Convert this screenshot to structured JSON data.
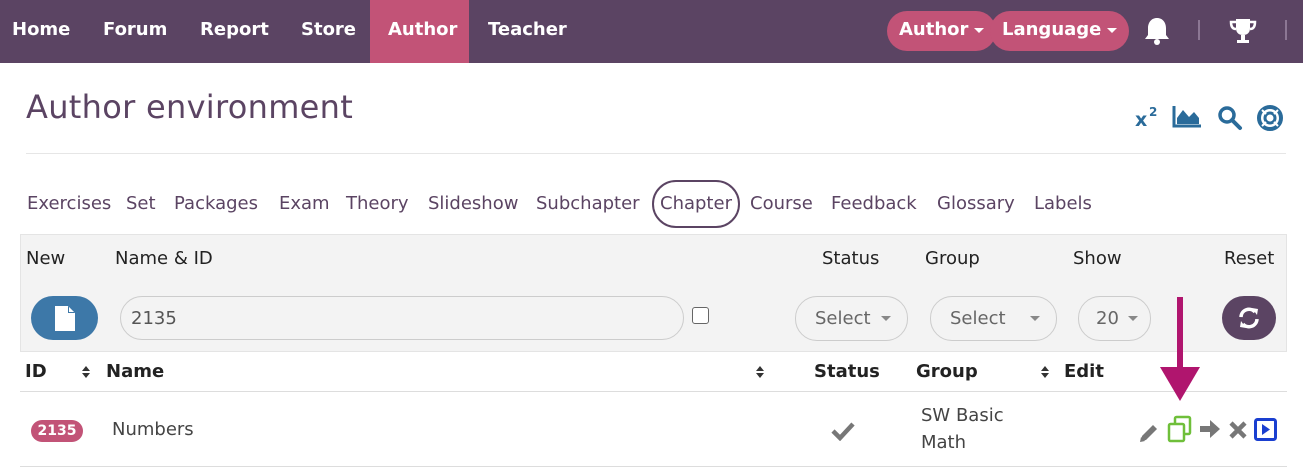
{
  "nav": {
    "links": [
      "Home",
      "Forum",
      "Report",
      "Store",
      "Author",
      "Teacher"
    ],
    "author_dropdown": "Author",
    "language_dropdown": "Language"
  },
  "page": {
    "title": "Author environment"
  },
  "tabs": [
    "Exercises",
    "Set",
    "Packages",
    "Exam",
    "Theory",
    "Slideshow",
    "Subchapter",
    "Chapter",
    "Course",
    "Feedback",
    "Glossary",
    "Labels"
  ],
  "active_tab": "Chapter",
  "filters": {
    "headers": {
      "new": "New",
      "name_id": "Name & ID",
      "status": "Status",
      "group": "Group",
      "show": "Show",
      "reset": "Reset"
    },
    "search_value": "2135",
    "status_select": "Select",
    "group_select": "Select",
    "show_select": "20"
  },
  "table": {
    "headers": {
      "id": "ID",
      "name": "Name",
      "status": "Status",
      "group": "Group",
      "edit": "Edit"
    },
    "rows": [
      {
        "id": "2135",
        "name": "Numbers",
        "group_line1": "SW Basic",
        "group_line2": "Math"
      }
    ]
  },
  "colors": {
    "nav_bg": "#5b4463",
    "accent": "#c25377",
    "blue": "#3d78a8",
    "copy_green": "#6fbf3a",
    "arrow_annotation": "#b0156e"
  },
  "icons": [
    "superscript-icon",
    "area-chart-icon",
    "search-icon",
    "help-lifebuoy-icon",
    "bell-icon",
    "trophy-icon",
    "file-icon",
    "refresh-icon",
    "pencil-icon",
    "copy-icon",
    "arrow-right-icon",
    "close-icon",
    "play-icon",
    "checkmark-icon"
  ]
}
